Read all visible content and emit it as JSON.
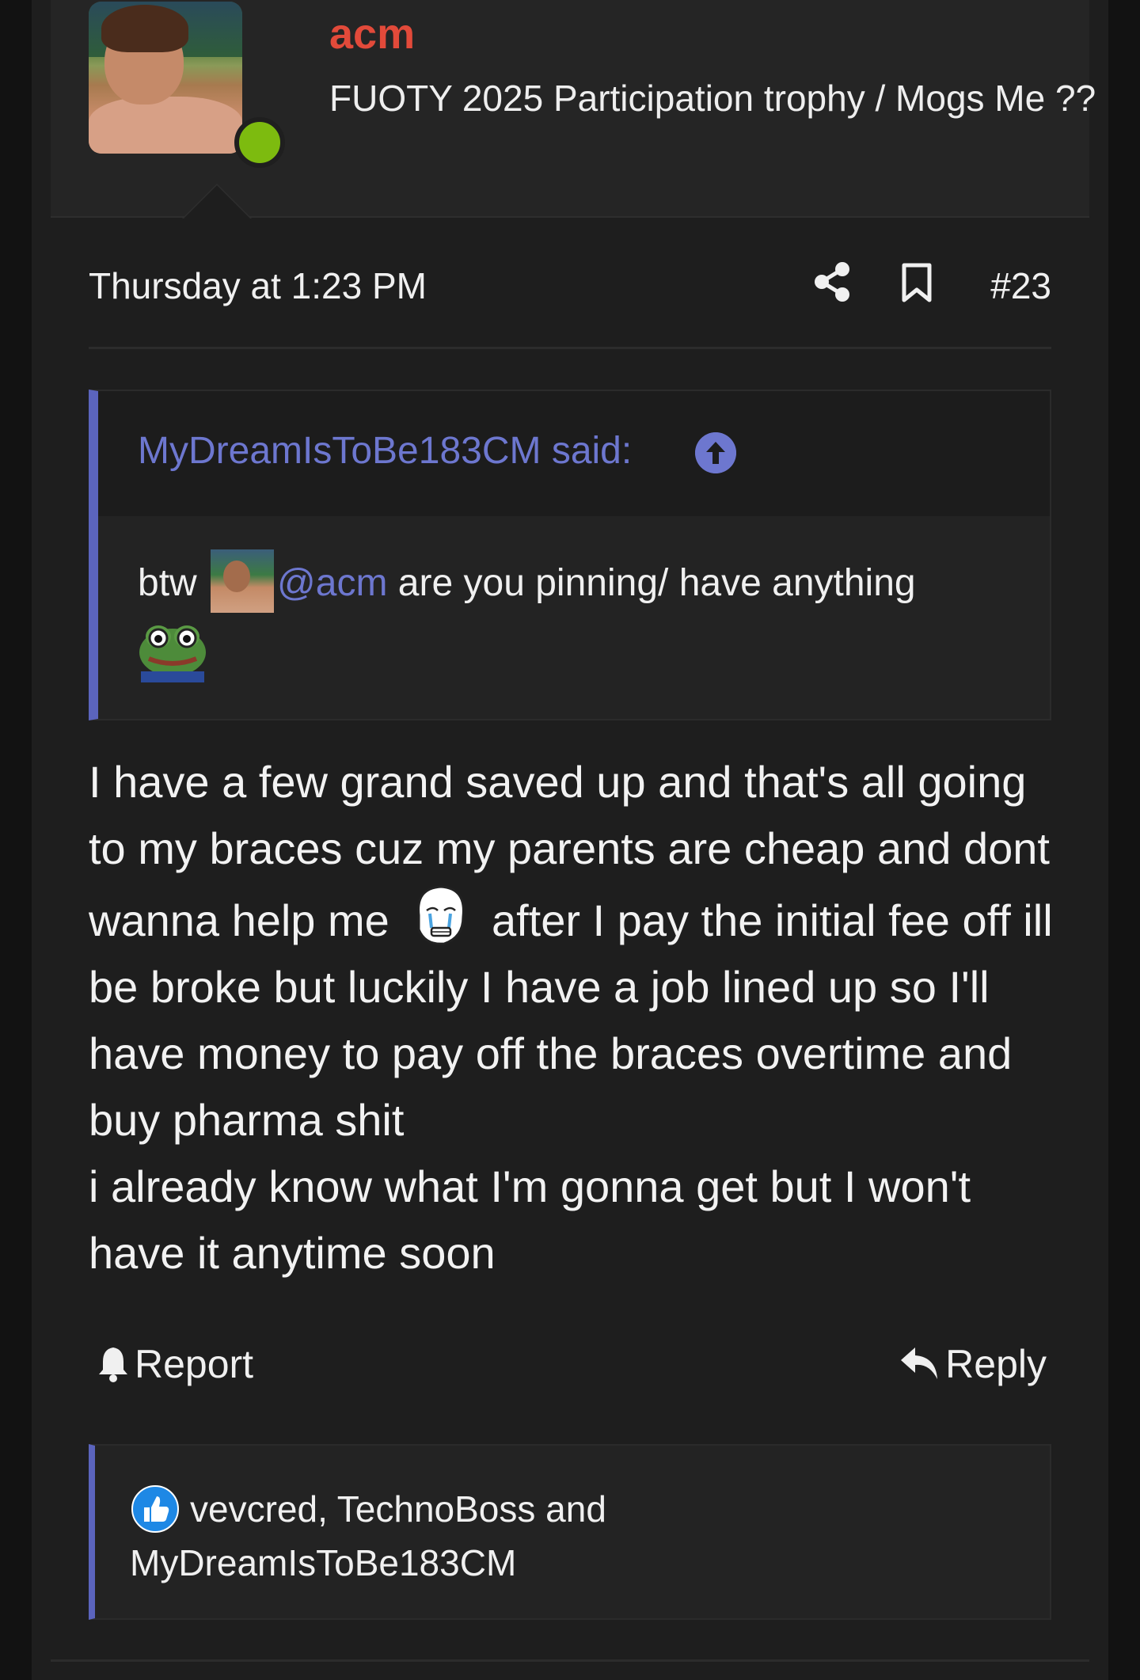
{
  "user": {
    "name": "acm",
    "title": "FUOTY 2025 Participation trophy / Mogs Me ??",
    "name_color": "#e24a3a",
    "online_status_color": "#7dbb0f"
  },
  "meta": {
    "date": "Thursday at 1:23 PM",
    "post_number": "#23",
    "share_icon": "share-icon",
    "bookmark_icon": "bookmark-icon"
  },
  "quote": {
    "author": "MyDreamIsToBe183CM said:",
    "text_before": "btw",
    "mention": "@acm",
    "text_after": "are you pinning/ have anything",
    "accent_color": "#5b64bd"
  },
  "message": {
    "part1": "I have a few grand saved up and that's all going to my braces cuz my parents are cheap and dont wanna help me",
    "part2": "after I pay the initial fee off ill be broke but luckily I have a job lined up so I'll have money to pay off the braces overtime and buy pharma shit",
    "part3": "i already know what I'm gonna get but I won't have it anytime soon"
  },
  "actions": {
    "report": "Report",
    "reply": "Reply"
  },
  "reactions": {
    "text": "vevcred, TechnoBoss and MyDreamIsToBe183CM",
    "icon": "like-icon"
  }
}
